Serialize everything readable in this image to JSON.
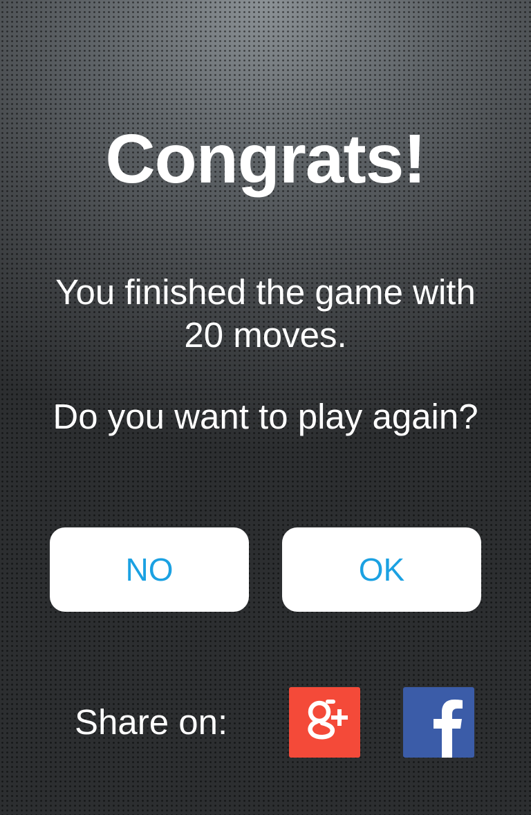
{
  "dialog": {
    "title": "Congrats!",
    "message_line1": "You finished the game with",
    "message_line2": "20 moves.",
    "question": "Do you want to play again?"
  },
  "buttons": {
    "no_label": "NO",
    "ok_label": "OK",
    "label_color": "#1ba1e2"
  },
  "share": {
    "label": "Share on:",
    "networks": [
      {
        "name": "google-plus-icon",
        "color": "#f44a39"
      },
      {
        "name": "facebook-icon",
        "color": "#3b5ca8"
      }
    ]
  }
}
